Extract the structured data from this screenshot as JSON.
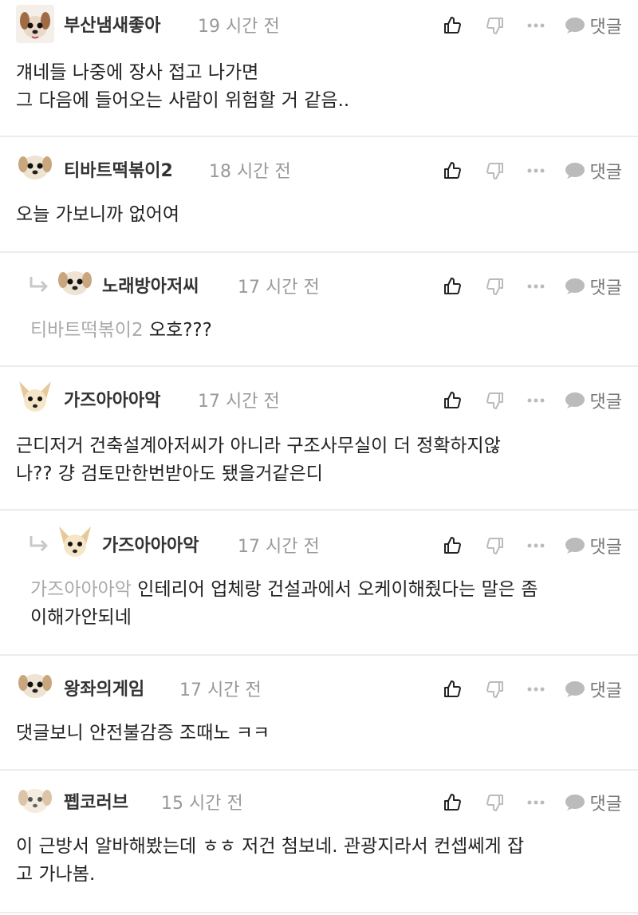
{
  "comments": [
    {
      "nick": "부산냄새좋아",
      "time": "19 시간 전",
      "text_lines": [
        "걔네들 나중에 장사 접고 나가면",
        "그 다음에 들어오는 사람이 위험할 거 같음.."
      ],
      "avatar": "dog-face-pixel",
      "is_reply": false
    },
    {
      "nick": "티바트떡볶이2",
      "time": "18 시간 전",
      "text_lines": [
        "오늘 가보니까 없어여"
      ],
      "avatar": "dog-face",
      "is_reply": false
    },
    {
      "nick": "노래방아저씨",
      "time": "17 시간 전",
      "mention": "티바트떡볶이2",
      "text_lines": [
        "오호???"
      ],
      "avatar": "dog-face",
      "is_reply": true
    },
    {
      "nick": "가즈아아아악",
      "time": "17 시간 전",
      "text_lines": [
        "근디저거 건축설계아저씨가 아니라 구조사무실이 더 정확하지않",
        "나?? 걍 검토만한번받아도 됐을거같은디"
      ],
      "avatar": "chihuahua-face",
      "is_reply": false
    },
    {
      "nick": "가즈아아아악",
      "time": "17 시간 전",
      "mention": "가즈아아아악",
      "text_lines": [
        "인테리어 업체랑 건설과에서 오케이해줬다는 말은 좀",
        "이해가안되네"
      ],
      "avatar": "chihuahua-face",
      "is_reply": true
    },
    {
      "nick": "왕좌의게임",
      "time": "17 시간 전",
      "text_lines": [
        "댓글보니 안전불감증 조때노 ㅋㅋ"
      ],
      "avatar": "dog-face",
      "is_reply": false
    },
    {
      "nick": "펩코러브",
      "time": "15 시간 전",
      "text_lines": [
        "이 근방서 알바해봤는데 ㅎㅎ 저건 첨보네. 관광지라서 컨셉쎄게 잡",
        "고 가나봄."
      ],
      "avatar": "dog-face-light",
      "is_reply": false
    }
  ],
  "labels": {
    "reply": "댓글"
  },
  "icons": {
    "like": "thumbs-up-icon",
    "dislike": "thumbs-down-icon",
    "more": "more-dots-icon",
    "reply": "speech-bubble-icon",
    "reply_arrow": "reply-arrow-icon"
  },
  "colors": {
    "nick": "#333333",
    "time": "#999999",
    "mention": "#aaaaaa",
    "divider": "#ececec",
    "icon": "#222222",
    "icon_light": "#bbbbbb"
  }
}
